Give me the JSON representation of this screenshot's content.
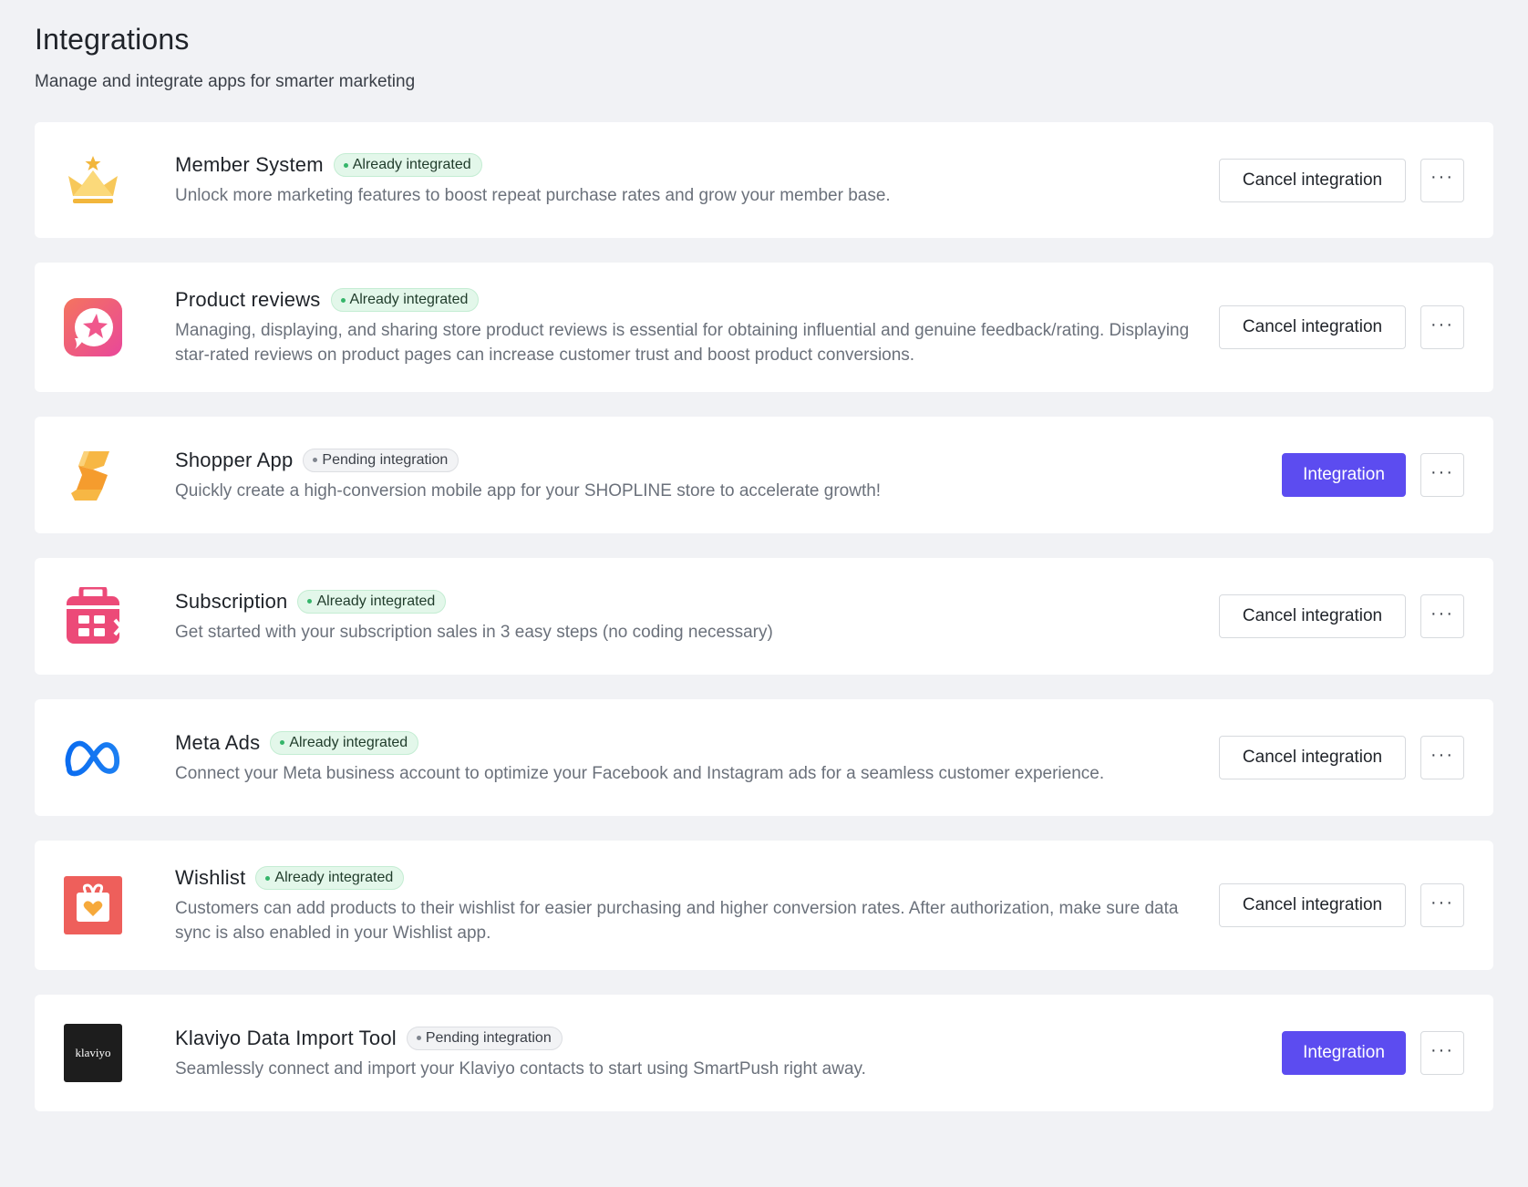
{
  "header": {
    "title": "Integrations",
    "subtitle": "Manage and integrate apps for smarter marketing"
  },
  "colors": {
    "accent": "#5c4cf0",
    "badge_done_bg": "#e3f7ea",
    "badge_done_dot": "#35b56a",
    "badge_pending_bg": "#f2f3f5"
  },
  "integrations": [
    {
      "name": "Member System",
      "icon": "crown-icon",
      "status": "Already integrated",
      "status_type": "done",
      "description": "Unlock more marketing features to boost repeat purchase rates and grow your member base.",
      "action_label": "Cancel integration",
      "action_type": "outline",
      "more_label": "···"
    },
    {
      "name": "Product reviews",
      "icon": "review-star-icon",
      "status": "Already integrated",
      "status_type": "done",
      "description": "Managing, displaying, and sharing store product reviews is essential for obtaining influential and genuine feedback/rating. Displaying star-rated reviews on product pages can increase customer trust and boost product conversions.",
      "action_label": "Cancel integration",
      "action_type": "outline",
      "more_label": "···"
    },
    {
      "name": "Shopper App",
      "icon": "shopper-app-icon",
      "status": "Pending integration",
      "status_type": "pending",
      "description": "Quickly create a high-conversion mobile app for your SHOPLINE store to accelerate growth!",
      "action_label": "Integration",
      "action_type": "primary",
      "more_label": "···"
    },
    {
      "name": "Subscription",
      "icon": "subscription-calendar-icon",
      "status": "Already integrated",
      "status_type": "done",
      "description": "Get started with your subscription sales in 3 easy steps (no coding necessary)",
      "action_label": "Cancel integration",
      "action_type": "outline",
      "more_label": "···"
    },
    {
      "name": "Meta Ads",
      "icon": "meta-logo-icon",
      "status": "Already integrated",
      "status_type": "done",
      "description": "Connect your Meta business account to optimize your Facebook and Instagram ads for a seamless customer experience.",
      "action_label": "Cancel integration",
      "action_type": "outline",
      "more_label": "···"
    },
    {
      "name": "Wishlist",
      "icon": "gift-heart-icon",
      "status": "Already integrated",
      "status_type": "done",
      "description": "Customers can add products to their wishlist for easier purchasing and higher conversion rates. After authorization, make sure data sync is also enabled in your Wishlist app.",
      "action_label": "Cancel integration",
      "action_type": "outline",
      "more_label": "···"
    },
    {
      "name": "Klaviyo Data Import Tool",
      "icon": "klaviyo-logo-icon",
      "logo_text": "klaviyo",
      "status": "Pending integration",
      "status_type": "pending",
      "description": "Seamlessly connect and import your Klaviyo contacts to start using SmartPush right away.",
      "action_label": "Integration",
      "action_type": "primary",
      "more_label": "···"
    }
  ]
}
